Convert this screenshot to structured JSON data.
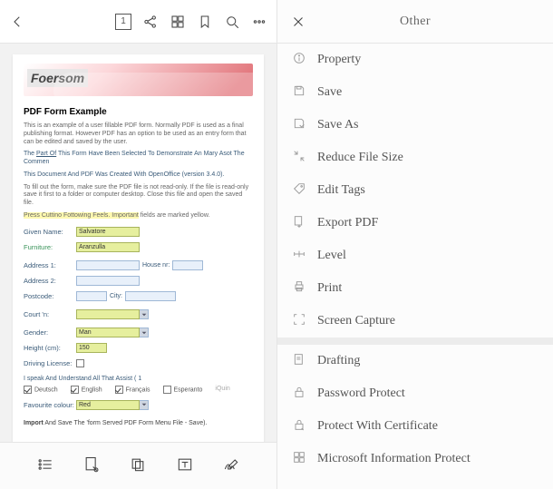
{
  "top_toolbar": {
    "page_number": "1"
  },
  "document": {
    "banner_name": "Foersom",
    "title": "PDF Form Example",
    "intro": "This is an example of a user fillable PDF form. Normally PDF is used as a final publishing format. However PDF has an option to be used as an entry form that can be edited and saved by the user.",
    "highlight_line_prefix": "The ",
    "highlight_line_u": "Part Of",
    "highlight_line_rest": " This Form Have Been Selected To Demonstrate An Mary Asot The Commen",
    "doc_line": "This Document And PDF Was Created With OpenOffice (version 3.4.0).",
    "fillout": "To fill out the form, make sure the PDF file is not read-only. If the file is read-only save it first to a folder or computer desktop. Close this file and open the saved file.",
    "required_prefix": "Press Cuttino Fottowing Feels. Important",
    "required_suffix": " fields are marked yellow.",
    "fields": {
      "given_name_label": "Given Name:",
      "given_name_value": "Salvatore",
      "furniture_label": "Furniture:",
      "furniture_value": "Aranzulla",
      "address1_label": "Address 1:",
      "housenr_label": "House nr:",
      "address2_label": "Address 2:",
      "postcode_label": "Postcode:",
      "city_label": "City:",
      "court_label": "Court 'n:",
      "gender_label": "Gender:",
      "gender_value": "Man",
      "height_label": "Height (cm):",
      "height_value": "150",
      "driving_label": "Driving License:",
      "speak_label": "I speak And Understand All That Assist ( 1",
      "deutsch": "Deutsch",
      "english": "English",
      "francais": "Français",
      "esperanto": "Esperanto",
      "iquin": "iQuin",
      "fav_label": "Favourite colour:",
      "fav_value": "Red"
    },
    "footer_b": "Import",
    "footer_1": "And Save The 'form",
    "footer_2": "Served PDF Form Menu File - Save)."
  },
  "right": {
    "title": "Other",
    "items": [
      {
        "id": "property",
        "label": "Property"
      },
      {
        "id": "save",
        "label": "Save"
      },
      {
        "id": "save-as",
        "label": "Save As"
      },
      {
        "id": "reduce",
        "label": "Reduce File Size"
      },
      {
        "id": "edit-tags",
        "label": "Edit Tags"
      },
      {
        "id": "export",
        "label": "Export PDF"
      },
      {
        "id": "level",
        "label": "Level"
      },
      {
        "id": "print",
        "label": "Print"
      },
      {
        "id": "screen-capture",
        "label": "Screen Capture"
      },
      {
        "id": "drafting",
        "label": "Drafting"
      },
      {
        "id": "password",
        "label": "Password Protect"
      },
      {
        "id": "cert",
        "label": "Protect With Certificate"
      },
      {
        "id": "mip",
        "label": "Microsoft Information Protect"
      }
    ]
  }
}
